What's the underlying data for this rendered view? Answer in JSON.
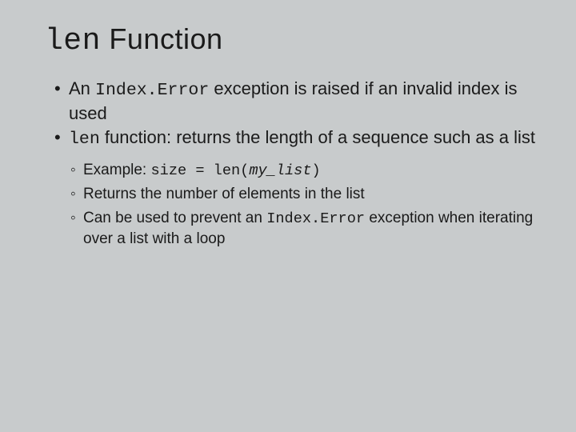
{
  "title": {
    "code": "len",
    "rest": " Function"
  },
  "bullets": {
    "b1": {
      "t1": "An ",
      "code": "Index.Error",
      "t2": " exception is raised if an  invalid index is used"
    },
    "b2": {
      "code": "len",
      "t1": " function: returns the length of a sequence such as a list"
    }
  },
  "subs": {
    "s1": {
      "t1": "Example: ",
      "code1": "size = len(",
      "ital": "my_list",
      "code2": ")"
    },
    "s2": {
      "t1": "Returns the number of elements in the list"
    },
    "s3": {
      "t1": "Can be used to prevent an ",
      "code": "Index.Error",
      "t2": "  exception when iterating over a list with a loop"
    }
  }
}
